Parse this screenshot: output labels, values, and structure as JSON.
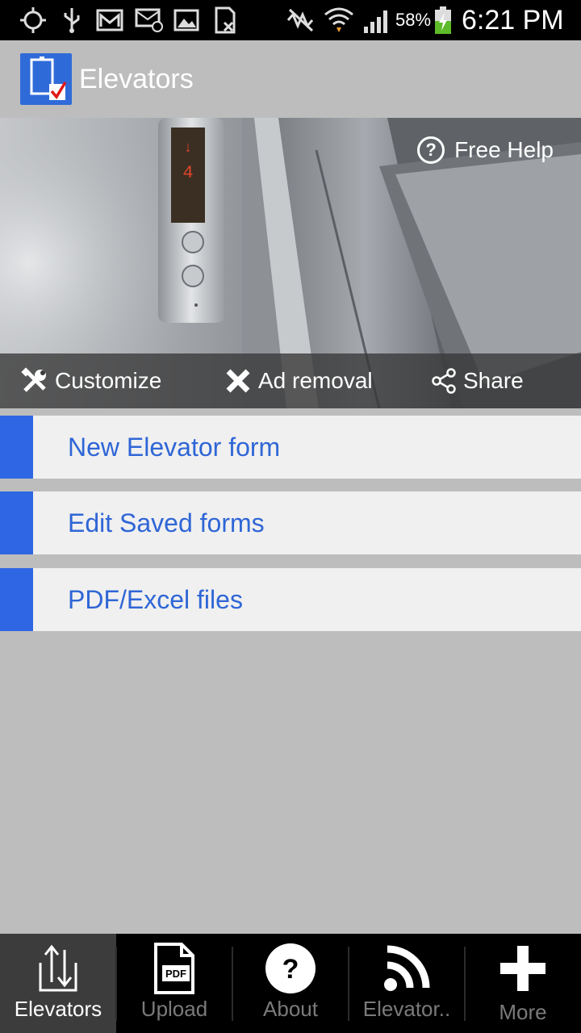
{
  "status_bar": {
    "battery_percent": "58%",
    "time": "6:21 PM",
    "icons": [
      "gps-icon",
      "usb-icon",
      "gmail-icon",
      "email-icon",
      "gallery-icon",
      "sim-icon",
      "mute-icon",
      "wifi-icon",
      "signal-icon",
      "battery-charging-icon"
    ]
  },
  "app_bar": {
    "title": "Elevators",
    "logo": "elevator-app-logo"
  },
  "hero": {
    "help_label": "Free Help",
    "toolbar": {
      "customize": "Customize",
      "ad_removal": "Ad removal",
      "share": "Share"
    }
  },
  "menu": {
    "items": [
      {
        "label": "New Elevator form"
      },
      {
        "label": "Edit Saved forms"
      },
      {
        "label": "PDF/Excel files"
      }
    ]
  },
  "tabs": [
    {
      "label": "Elevators",
      "icon": "transfer-arrows-icon",
      "active": true
    },
    {
      "label": "Upload",
      "icon": "pdf-file-icon"
    },
    {
      "label": "About",
      "icon": "question-icon"
    },
    {
      "label": "Elevator..",
      "icon": "rss-icon"
    },
    {
      "label": "More",
      "icon": "plus-icon"
    }
  ],
  "colors": {
    "accent": "#2f66e4",
    "link_text": "#2f66d6",
    "background": "#bdbdbd",
    "tab_bar": "#000000"
  }
}
